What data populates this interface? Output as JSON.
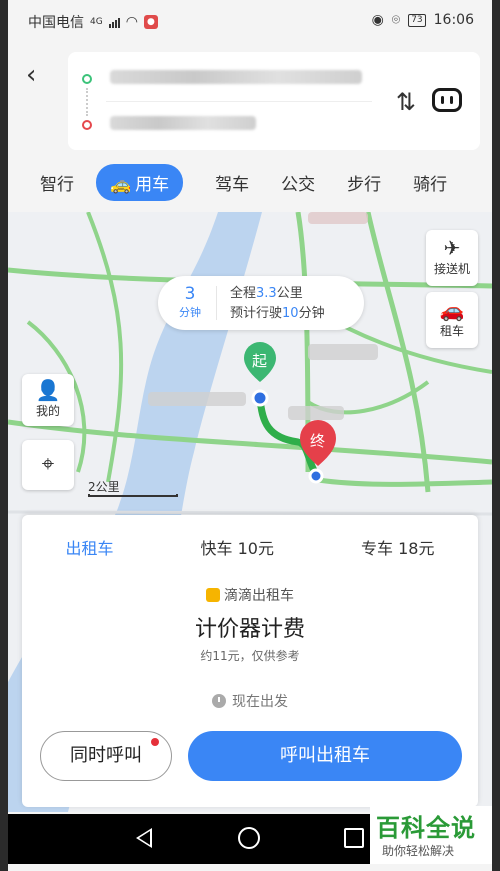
{
  "status_bar": {
    "carrier": "中国电信",
    "network": "4G",
    "battery": "73",
    "time": "16:06"
  },
  "route": {
    "start_placeholder": "",
    "end_placeholder": ""
  },
  "tabs": [
    {
      "label": "智行"
    },
    {
      "label": "用车",
      "active": true
    },
    {
      "label": "驾车"
    },
    {
      "label": "公交"
    },
    {
      "label": "步行"
    },
    {
      "label": "骑行"
    }
  ],
  "map": {
    "side_right": {
      "airport": "接送机",
      "rental": "租车"
    },
    "side_left": {
      "mine": "我的"
    },
    "summary": {
      "minutes": "3",
      "minutes_unit": "分钟",
      "line1_pre": "全程",
      "distance": "3.3",
      "line1_post": "公里",
      "line2_pre": "预计行驶",
      "drive_minutes": "10",
      "line2_post": "分钟"
    },
    "start_marker": "起",
    "end_marker": "终",
    "scale_label": "2公里",
    "colors": {
      "road": "#8fd48a",
      "river": "#bcd4ef",
      "route": "#2fae4a",
      "start": "#3cb772",
      "end": "#e5404a"
    }
  },
  "card": {
    "tabs": [
      {
        "label": "出租车",
        "active": true
      },
      {
        "label": "快车 10元"
      },
      {
        "label": "专车 18元"
      }
    ],
    "provider": "滴滴出租车",
    "fare_title": "计价器计费",
    "fare_note": "约11元，仅供参考",
    "depart": "现在出发",
    "btn_both": "同时呼叫",
    "btn_call": "呼叫出租车"
  },
  "watermark": {
    "top": "百科全说",
    "bottom": "助你轻松解决"
  },
  "icons": [
    "back-icon",
    "swap-icon",
    "voice-icon",
    "car-icon",
    "plane-icon",
    "rental-car-icon",
    "person-icon",
    "locate-icon",
    "clock-icon",
    "nav-back-icon",
    "nav-home-icon",
    "nav-recent-icon"
  ]
}
